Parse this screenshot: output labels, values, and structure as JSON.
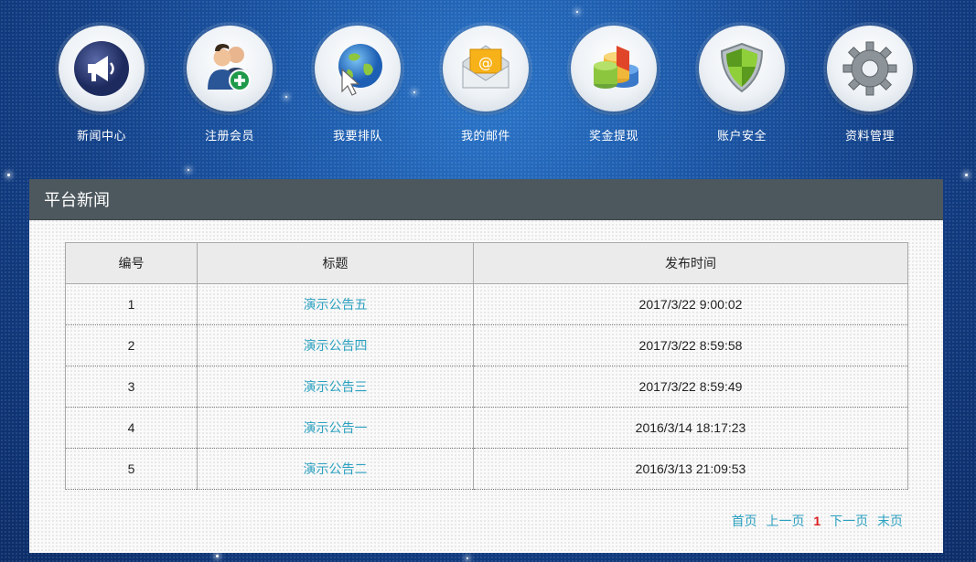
{
  "nav": [
    {
      "label": "新闻中心",
      "icon": "megaphone-icon"
    },
    {
      "label": "注册会员",
      "icon": "add-user-icon"
    },
    {
      "label": "我要排队",
      "icon": "globe-cursor-icon"
    },
    {
      "label": "我的邮件",
      "icon": "mail-icon"
    },
    {
      "label": "奖金提现",
      "icon": "chart-icon"
    },
    {
      "label": "账户安全",
      "icon": "shield-icon"
    },
    {
      "label": "资料管理",
      "icon": "gear-icon"
    }
  ],
  "panel": {
    "title": "平台新闻"
  },
  "table": {
    "headers": [
      "编号",
      "标题",
      "发布时间"
    ],
    "rows": [
      {
        "id": "1",
        "title": "演示公告五",
        "time": "2017/3/22 9:00:02"
      },
      {
        "id": "2",
        "title": "演示公告四",
        "time": "2017/3/22 8:59:58"
      },
      {
        "id": "3",
        "title": "演示公告三",
        "time": "2017/3/22 8:59:49"
      },
      {
        "id": "4",
        "title": "演示公告一",
        "time": "2016/3/14 18:17:23"
      },
      {
        "id": "5",
        "title": "演示公告二",
        "time": "2016/3/13 21:09:53"
      }
    ]
  },
  "pager": {
    "first": "首页",
    "prev": "上一页",
    "current": "1",
    "next": "下一页",
    "last": "末页"
  }
}
